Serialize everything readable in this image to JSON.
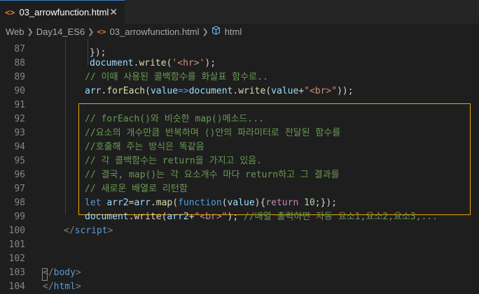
{
  "tab": {
    "icon": "<>",
    "title": "03_arrowfunction.html",
    "close": "✕"
  },
  "breadcrumb": {
    "items": [
      "Web",
      "Day14_ES6",
      "03_arrowfunction.html",
      "html"
    ],
    "separator": "❯",
    "file_icon": "<>",
    "element_icon": "cube-icon"
  },
  "lines": [
    {
      "num": "87",
      "code": [
        {
          "t": "punc",
          "v": ""
        }
      ]
    },
    {
      "num": "88",
      "code": [
        {
          "t": "ident",
          "v": "document"
        },
        {
          "t": "punc",
          "v": "."
        },
        {
          "t": "fn",
          "v": "write"
        },
        {
          "t": "punc",
          "v": "("
        },
        {
          "t": "str",
          "v": "'<hr>'"
        },
        {
          "t": "punc",
          "v": ");"
        }
      ]
    },
    {
      "num": "89",
      "code": [
        {
          "t": "comment",
          "v": "// 이때 사용된 콜백함수를 화살표 함수로.."
        }
      ]
    },
    {
      "num": "90",
      "code": [
        {
          "t": "ident",
          "v": "arr"
        },
        {
          "t": "punc",
          "v": "."
        },
        {
          "t": "fn",
          "v": "forEach"
        },
        {
          "t": "punc",
          "v": "("
        },
        {
          "t": "ident",
          "v": "value"
        },
        {
          "t": "kw",
          "v": "=>"
        },
        {
          "t": "ident",
          "v": "document"
        },
        {
          "t": "punc",
          "v": "."
        },
        {
          "t": "fn",
          "v": "write"
        },
        {
          "t": "punc",
          "v": "("
        },
        {
          "t": "ident",
          "v": "value"
        },
        {
          "t": "punc",
          "v": "+"
        },
        {
          "t": "str",
          "v": "\"<br>\""
        },
        {
          "t": "punc",
          "v": "));"
        }
      ]
    },
    {
      "num": "91",
      "code": []
    },
    {
      "num": "92",
      "code": [
        {
          "t": "comment",
          "v": "// forEach()와 비슷한 map()메소드..."
        }
      ]
    },
    {
      "num": "93",
      "code": [
        {
          "t": "comment",
          "v": "//요소의 개수만큼 반복하며 ()안의 파라미터로 전달된 함수를"
        }
      ]
    },
    {
      "num": "94",
      "code": [
        {
          "t": "comment",
          "v": "//호출해 주는 방식은 똑같음"
        }
      ]
    },
    {
      "num": "95",
      "code": [
        {
          "t": "comment",
          "v": "// 각 콜백함수는 return을 가지고 있음."
        }
      ]
    },
    {
      "num": "96",
      "code": [
        {
          "t": "comment",
          "v": "// 결국, map()는 각 요소개수 마다 return하고 그 결과를"
        }
      ]
    },
    {
      "num": "97",
      "code": [
        {
          "t": "comment",
          "v": "// 새로운 배열로 리턴함"
        }
      ]
    },
    {
      "num": "98",
      "code": [
        {
          "t": "kw",
          "v": "let"
        },
        {
          "t": "punc",
          "v": " "
        },
        {
          "t": "ident",
          "v": "arr2"
        },
        {
          "t": "punc",
          "v": "="
        },
        {
          "t": "ident",
          "v": "arr"
        },
        {
          "t": "punc",
          "v": "."
        },
        {
          "t": "fn",
          "v": "map"
        },
        {
          "t": "punc",
          "v": "("
        },
        {
          "t": "kw",
          "v": "function"
        },
        {
          "t": "punc",
          "v": "("
        },
        {
          "t": "ident",
          "v": "value"
        },
        {
          "t": "punc",
          "v": "){"
        },
        {
          "t": "ctrl",
          "v": "return"
        },
        {
          "t": "punc",
          "v": " "
        },
        {
          "t": "num",
          "v": "10"
        },
        {
          "t": "punc",
          "v": ";});"
        }
      ]
    },
    {
      "num": "99",
      "code": [
        {
          "t": "ident",
          "v": "document"
        },
        {
          "t": "punc",
          "v": "."
        },
        {
          "t": "fn",
          "v": "write"
        },
        {
          "t": "punc",
          "v": "("
        },
        {
          "t": "ident",
          "v": "arr2"
        },
        {
          "t": "punc",
          "v": "+"
        },
        {
          "t": "str",
          "v": "\"<br>\""
        },
        {
          "t": "punc",
          "v": "); "
        },
        {
          "t": "comment",
          "v": "//배열 출력하면 자동 요소1,요소2,요소3,..."
        }
      ]
    },
    {
      "num": "100",
      "code": [
        {
          "t": "bracket",
          "v": "</"
        },
        {
          "t": "tag",
          "v": "script"
        },
        {
          "t": "bracket",
          "v": ">"
        }
      ]
    },
    {
      "num": "101",
      "code": []
    },
    {
      "num": "102",
      "code": []
    },
    {
      "num": "103",
      "code": [
        {
          "t": "bracket",
          "v": "</"
        },
        {
          "t": "tag",
          "v": "body"
        },
        {
          "t": "bracket",
          "v": ">"
        }
      ]
    },
    {
      "num": "104",
      "code": [
        {
          "t": "bracket",
          "v": "</"
        },
        {
          "t": "tag",
          "v": "html"
        },
        {
          "t": "bracket",
          "v": ">"
        }
      ]
    }
  ],
  "colors": {
    "highlight_border": "#f0a30a",
    "tab_accent": "#3c7cc4"
  }
}
